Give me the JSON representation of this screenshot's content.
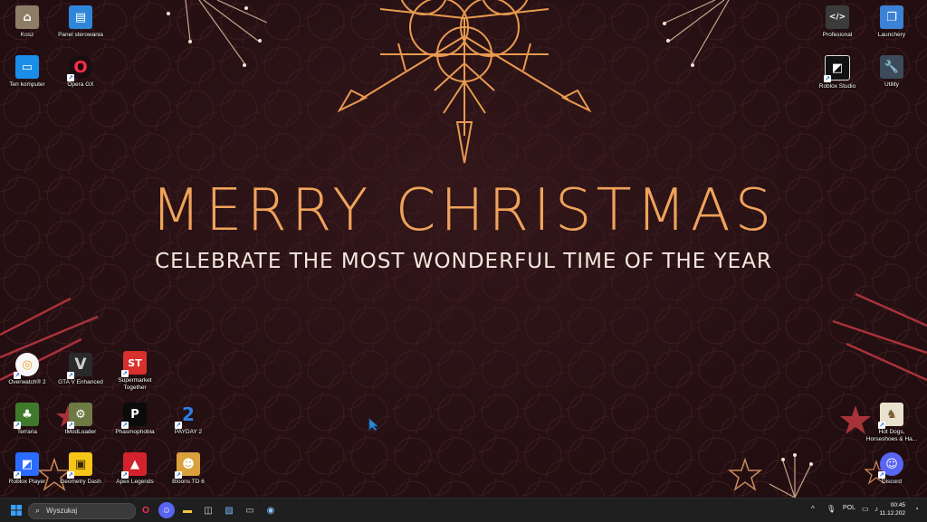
{
  "wallpaper": {
    "headline": "MERRY CHRISTMAS",
    "subheadline": "CELEBRATE THE MOST WONDERFUL TIME OF THE YEAR"
  },
  "desktop_icons": {
    "kosz": "Kosz",
    "panel": "Panel sterowania",
    "ten_komputer": "Ten komputer",
    "opera": "Opera GX",
    "profesional": "Profesional",
    "launchery": "Launchery",
    "roblox_studio": "Roblox Studio",
    "utility": "Utility",
    "overwatch": "Overwatch® 2",
    "gta": "GTA V Enhanced",
    "supermarket": "Supermarket Together",
    "terraria": "Terraria",
    "tmodloader": "tModLoader",
    "phasmophobia": "Phasmophobia",
    "payday": "PAYDAY 2",
    "hotdogs": "Hot Dogs, Horseshoes & Ha...",
    "roblox_player": "Roblox Player",
    "geometry": "Geometry Dash",
    "apex": "Apex Legends",
    "bloons": "Bloons TD 6",
    "discord": "Discord"
  },
  "taskbar": {
    "search_placeholder": "Wyszukaj",
    "language": "POL",
    "time": "00:45",
    "date": "11.12.202"
  },
  "colors": {
    "accent_orange": "#f0a35a",
    "background": "#2a1214",
    "taskbar": "#1f1f1f"
  }
}
